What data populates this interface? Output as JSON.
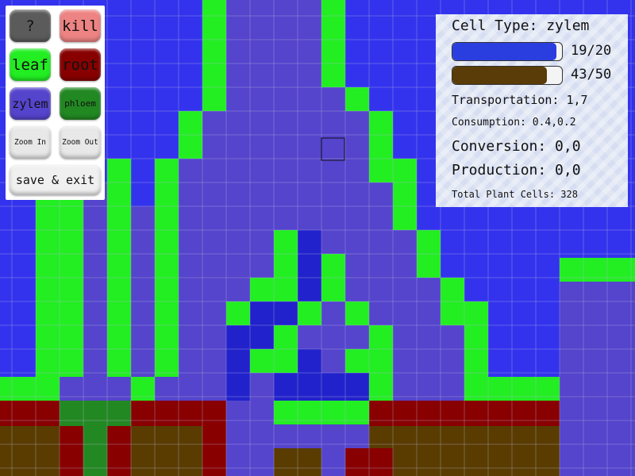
{
  "palette": {
    "help_label": "?",
    "kill_label": "kill",
    "leaf_label": "leaf",
    "root_label": "root",
    "zylem_label": "zylem",
    "phloem_label": "phloem",
    "zoom_in_label": "Zoom In",
    "zoom_out_label": "Zoom Out",
    "save_exit_label": "save & exit"
  },
  "info": {
    "cell_type": "Cell Type: zylem",
    "bar1": {
      "label": "19/20",
      "value": 19,
      "max": 20
    },
    "bar2": {
      "label": "43/50",
      "value": 43,
      "max": 50
    },
    "transportation": "Transportation: 1,7",
    "consumption": "Consumption: 0.4,0.2",
    "conversion": "Conversion: 0,0",
    "production": "Production: 0,0",
    "total_cells": "Total Plant Cells: 328"
  },
  "colors": {
    "sky": "#3333ee",
    "leaf": "#22ee22",
    "zylem": "#5544cc",
    "phloem": "#228822",
    "root": "#880000",
    "soil": "#5a3c00",
    "deep_blue": "#2222cc"
  }
}
